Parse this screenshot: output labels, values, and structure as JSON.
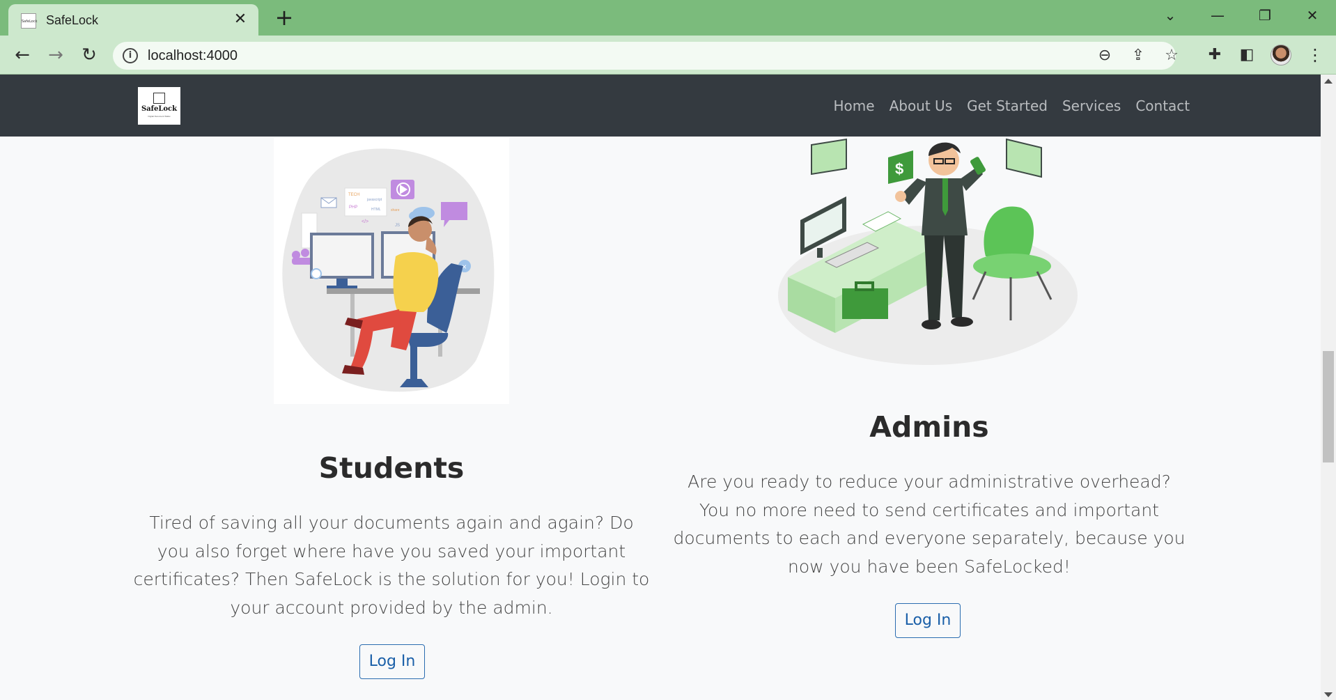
{
  "browser": {
    "tab_title": "SafeLock",
    "favicon_text": "SafeLock",
    "url": "localhost:4000"
  },
  "navbar": {
    "brand": "SafeLock",
    "brand_sub": "Digital Document Wallet",
    "links": [
      "Home",
      "About Us",
      "Get Started",
      "Services",
      "Contact"
    ]
  },
  "students": {
    "title": "Students",
    "text": "Tired of saving all your documents again and again? Do you also forget where have you saved your important certificates? Then SafeLock is the solution for you! Login to your account provided by the admin.",
    "button": "Log In",
    "illustration_labels": [
      "TECH",
      "javascript",
      "PHP",
      "HTML",
      "share",
      "JS",
      "</>"
    ]
  },
  "admins": {
    "title": "Admins",
    "text": "Are you ready to reduce your administrative overhead? You no more need to send certificates and important documents to each and everyone separately, because you now you have been SafeLocked!",
    "button": "Log In",
    "illustration_labels": [
      "$"
    ]
  },
  "icons": {
    "back": "back-arrow-icon",
    "forward": "forward-arrow-icon",
    "reload": "reload-icon",
    "info": "info-icon",
    "zoom": "zoom-out-icon",
    "share": "share-icon",
    "star": "bookmark-star-icon",
    "extensions": "puzzle-icon",
    "sidepanel": "side-panel-icon",
    "menu": "kebab-menu-icon"
  },
  "colors": {
    "chrome_frame": "#7bbb7c",
    "chrome_toolbar": "#cde8cd",
    "navbar": "#343a40",
    "link": "#1a5fa8"
  }
}
